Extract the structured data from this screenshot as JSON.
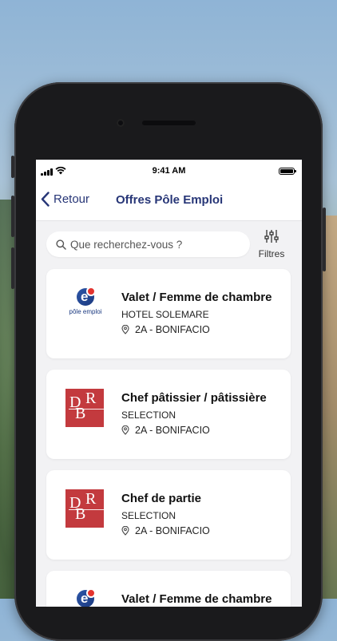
{
  "status_bar": {
    "time": "9:41 AM"
  },
  "nav": {
    "back_label": "Retour",
    "title": "Offres Pôle Emploi"
  },
  "search": {
    "placeholder": "Que recherchez-vous ?"
  },
  "filters": {
    "label": "Filtres"
  },
  "offers": [
    {
      "title": "Valet / Femme de chambre",
      "company": "HOTEL SOLEMARE",
      "location": "2A - BONIFACIO",
      "logo": "pole-emploi-logo",
      "logo_text": "pôle emploi"
    },
    {
      "title": "Chef pâtissier / pâtissière",
      "company": "SELECTION",
      "location": "2A - BONIFACIO",
      "logo": "db-logo"
    },
    {
      "title": "Chef de partie",
      "company": "SELECTION",
      "location": "2A - BONIFACIO",
      "logo": "db-logo"
    },
    {
      "title": "Valet / Femme de chambre",
      "logo": "pole-emploi-logo"
    }
  ],
  "colors": {
    "accent": "#273677",
    "logo_red": "#c33a3e",
    "screen_bg": "#f2f2f4"
  }
}
